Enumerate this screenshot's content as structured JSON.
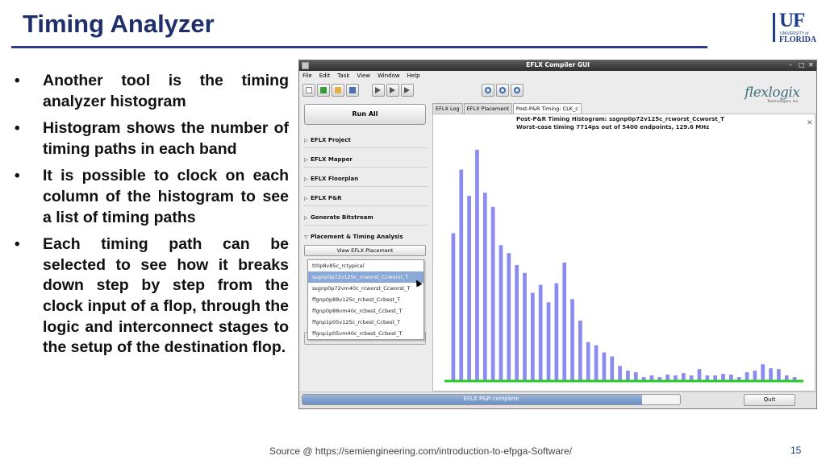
{
  "slide": {
    "title": "Timing Analyzer",
    "bullets": [
      "Another tool is the timing analyzer histogram",
      "Histogram shows the number of timing paths in each band",
      "It is possible to clock on each column of the histogram to see a list of timing paths",
      "Each timing path can be selected to see how it breaks down step by step from the clock input of a flop, through the logic and interconnect stages to the setup of the destination flop."
    ],
    "bullet_glyph": "•",
    "source": "Source @ https://semiengineering.com/introduction-to-efpga-Software/",
    "page_number": "15",
    "logo": {
      "main": "UF",
      "sub": "UNIVERSITY of",
      "name": "FLORIDA"
    }
  },
  "window": {
    "title": "EFLX Compiler GUI",
    "controls": [
      "–",
      "□",
      "✕"
    ],
    "menu": [
      "File",
      "Edit",
      "Task",
      "View",
      "Window",
      "Help"
    ],
    "toolbar_icons": [
      "new-project-icon",
      "download-icon",
      "open-folder-icon",
      "save-icon",
      "run-step-icon",
      "run-next-icon",
      "run-all-icon",
      "zoom-in-icon",
      "zoom-out-icon",
      "zoom-fit-icon"
    ],
    "brand": "flexlogix",
    "brand_sub": "Technologies, Inc.",
    "run_all": "Run All",
    "sections": [
      "EFLX Project",
      "EFLX Mapper",
      "EFLX Floorplan",
      "EFLX P&R",
      "Generate Bitstream",
      "Placement & Timing Analysis"
    ],
    "section_arrows": [
      "▷",
      "▽"
    ],
    "view_placement": "View EFLX Placement",
    "corners": [
      "tt0p8v85c_rctypical",
      "ssgnp0p72v125c_rcworst_Ccworst_T",
      "ssgnp0p72vm40c_rcworst_Ccworst_T",
      "ffgnp0p88v125c_rcbest_Ccbest_T",
      "ffgnp0p88vm40c_rcbest_Ccbest_T",
      "ffgnp1p05v125c_rcbest_Ccbest_T",
      "ffgnp1p05vm40c_rcbest_Ccbest_T"
    ],
    "selected_corner_index": 1,
    "tabs": [
      "EFLX Log",
      "EFLX Placement",
      "Post-P&R Timing: CLK_c"
    ],
    "active_tab_index": 2,
    "histogram_title": "Post-P&R Timing Histogram: ssgnp0p72v125c_rcworst_Ccworst_T",
    "histogram_subtitle": "Worst-case timing 7714ps out of 5400 endpoints, 129.6 MHz",
    "close_glyph": "✕",
    "status": "EFLX P&R complete",
    "progress": 0.9,
    "quit": "Quit",
    "colors": {
      "bar": "#8c8cf0",
      "baseline": "#22cc22"
    }
  },
  "chart_data": {
    "type": "bar",
    "title": "Post-P&R Timing Histogram: ssgnp0p72v125c_rcworst_Ccworst_T",
    "xlabel": "",
    "ylabel": "",
    "ylim": [
      0,
      300
    ],
    "grid": false,
    "categories": [],
    "values": [
      185,
      265,
      232,
      290,
      236,
      218,
      170,
      160,
      145,
      135,
      110,
      120,
      98,
      122,
      148,
      102,
      75,
      48,
      44,
      35,
      30,
      18,
      12,
      10,
      4,
      6,
      4,
      7,
      6,
      9,
      6,
      14,
      6,
      6,
      8,
      7,
      4,
      10,
      12,
      20,
      15,
      14,
      6,
      4
    ]
  }
}
